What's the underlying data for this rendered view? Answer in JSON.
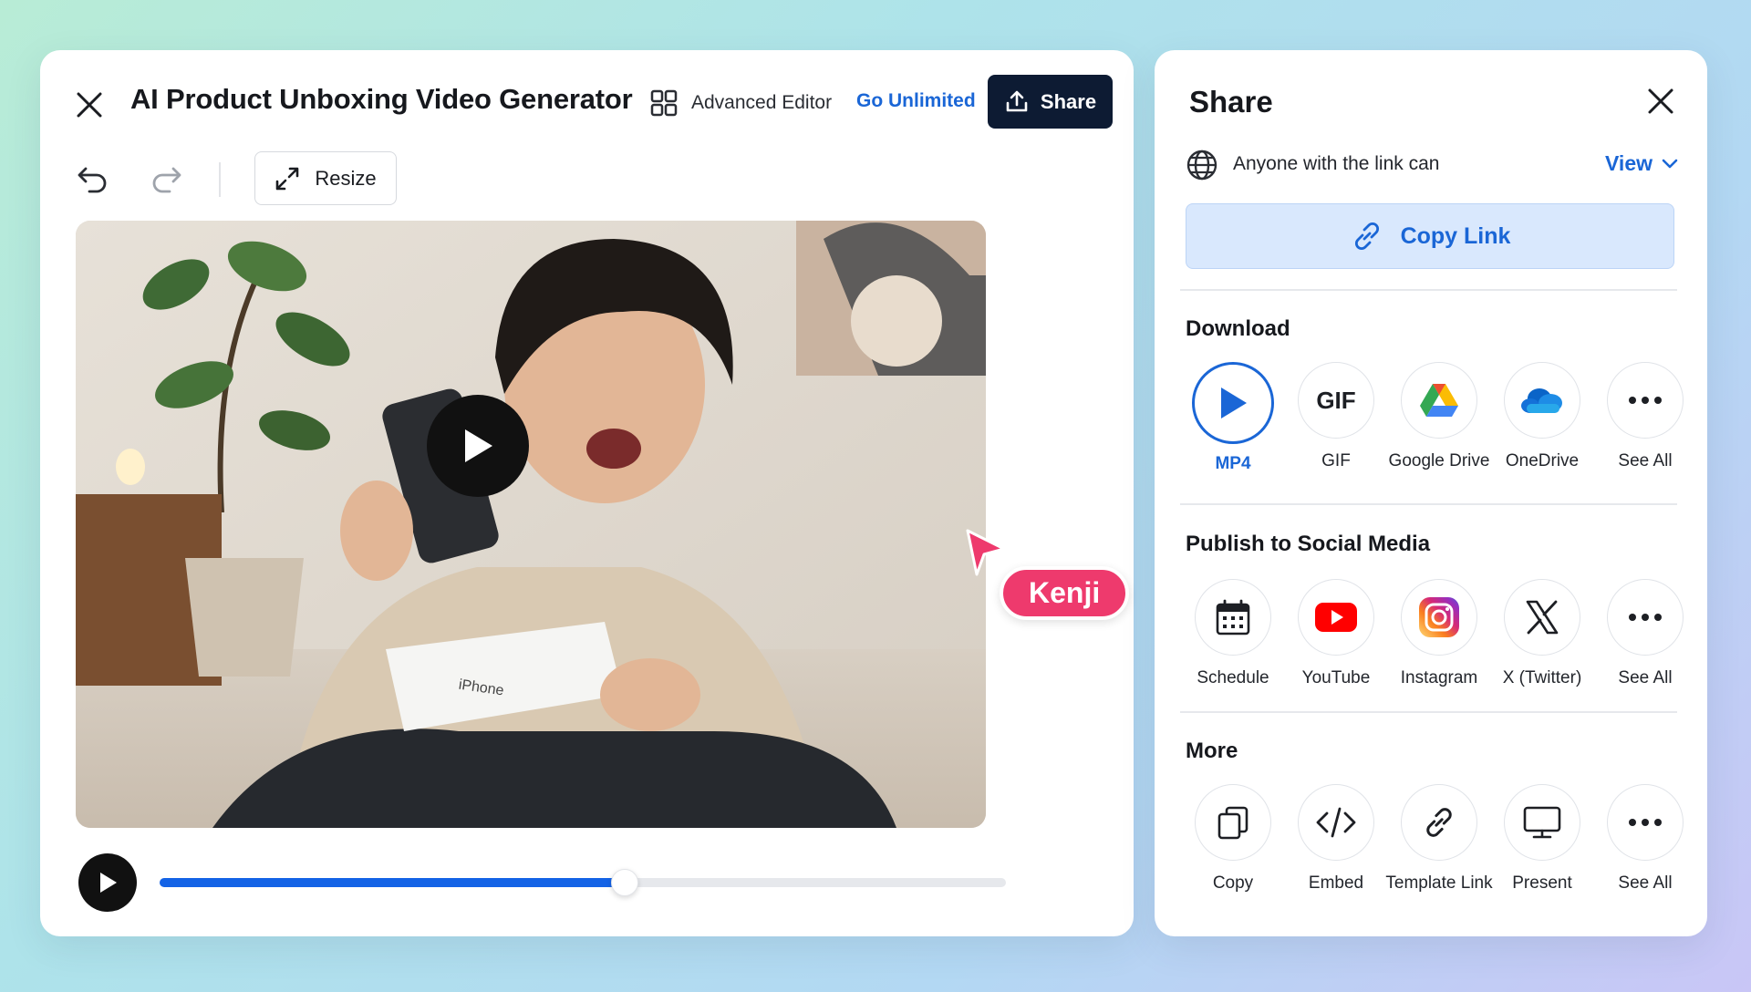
{
  "editor": {
    "title": "AI Product Unboxing Video Generator",
    "advanced_editor_label": "Advanced Editor",
    "go_unlimited_label": "Go Unlimited",
    "share_label": "Share",
    "resize_label": "Resize",
    "collaborator_name": "Kenji",
    "video_box_text": "iPhone",
    "playback_progress": 0.55,
    "accent_color": "#1463e6",
    "collaborator_color": "#ee3a6d"
  },
  "share_panel": {
    "title": "Share",
    "access_text": "Anyone with the link can",
    "access_level": "View",
    "copy_link_label": "Copy Link",
    "download": {
      "title": "Download",
      "options": [
        {
          "label": "MP4",
          "icon": "play-icon",
          "selected": true
        },
        {
          "label": "GIF",
          "icon": "gif-icon",
          "text": "GIF"
        },
        {
          "label": "Google Drive",
          "icon": "google-drive-icon"
        },
        {
          "label": "OneDrive",
          "icon": "onedrive-icon"
        },
        {
          "label": "See All",
          "icon": "more-icon"
        }
      ]
    },
    "social": {
      "title": "Publish to Social Media",
      "options": [
        {
          "label": "Schedule",
          "icon": "calendar-icon"
        },
        {
          "label": "YouTube",
          "icon": "youtube-icon"
        },
        {
          "label": "Instagram",
          "icon": "instagram-icon"
        },
        {
          "label": "X (Twitter)",
          "icon": "x-icon"
        },
        {
          "label": "See All",
          "icon": "more-icon"
        }
      ]
    },
    "more": {
      "title": "More",
      "options": [
        {
          "label": "Copy",
          "icon": "copy-icon"
        },
        {
          "label": "Embed",
          "icon": "code-icon"
        },
        {
          "label": "Template Link",
          "icon": "link-icon"
        },
        {
          "label": "Present",
          "icon": "monitor-icon"
        },
        {
          "label": "See All",
          "icon": "more-icon"
        }
      ]
    }
  }
}
